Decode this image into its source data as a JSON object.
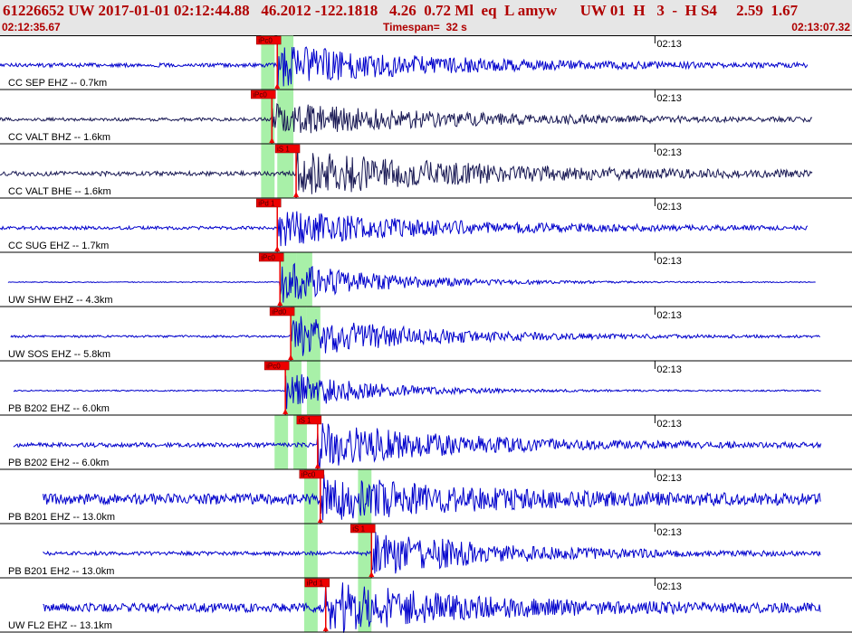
{
  "header": {
    "title": "61226652 UW 2017-01-01 02:12:44.88   46.2012 -122.1818   4.26  0.72 Ml  eq  L amyw      UW 01  H   3  -  H S4     2.59  1.67",
    "start_time": "02:12:35.67",
    "timespan": "Timespan=  32 s",
    "end_time": "02:13:07.32"
  },
  "colors": {
    "header_bg": "#e6e6e6",
    "header_text": "#b00000",
    "trace_blue": "#0000cc",
    "trace_dark": "#1a1a55",
    "pick_box": "#ee0000",
    "pick_window": "#a8f0a8"
  },
  "chart_data": {
    "type": "line",
    "title": "",
    "xlabel": "",
    "ylabel": "",
    "x_unit": "seconds after 02:12:35.67",
    "xlim": [
      0,
      31.65
    ],
    "minute_mark": {
      "label": "02:13",
      "time_s": 24.33
    },
    "traces": [
      {
        "station": "CC SEP EHZ -- 0.7km",
        "color": "#0000cc",
        "noise": 0.035,
        "amp": 0.38,
        "decay": 5.5,
        "start_s": 0.0,
        "end_s": 30.0,
        "picks": [
          {
            "label": "iPc0",
            "time_s": 10.3
          }
        ],
        "windows": [
          [
            9.7,
            10.2
          ],
          [
            10.3,
            10.9
          ]
        ]
      },
      {
        "station": "CC VALT BHZ -- 1.6km",
        "color": "#1a1a55",
        "noise": 0.03,
        "amp": 0.3,
        "decay": 6.5,
        "start_s": 0.0,
        "end_s": 30.2,
        "picks": [
          {
            "label": "iPc0",
            "time_s": 10.1
          }
        ],
        "windows": [
          [
            9.7,
            10.2
          ],
          [
            10.3,
            10.9
          ]
        ]
      },
      {
        "station": "CC VALT BHE -- 1.6km",
        "color": "#1a1a55",
        "noise": 0.04,
        "amp": 0.4,
        "decay": 7.0,
        "start_s": 0.0,
        "end_s": 30.2,
        "picks": [
          {
            "label": "iS 1",
            "time_s": 11.0
          }
        ],
        "windows": [
          [
            9.7,
            10.2
          ],
          [
            10.3,
            10.9
          ]
        ]
      },
      {
        "station": "CC SUG EHZ -- 1.7km",
        "color": "#0000cc",
        "noise": 0.03,
        "amp": 0.32,
        "decay": 6.0,
        "start_s": 0.0,
        "end_s": 30.0,
        "picks": [
          {
            "label": "iPd 1",
            "time_s": 10.3
          }
        ],
        "windows": []
      },
      {
        "station": "UW SHW EHZ -- 4.3km",
        "color": "#0000cc",
        "noise": 0.008,
        "amp": 0.42,
        "decay": 3.5,
        "start_s": 0.3,
        "end_s": 30.3,
        "picks": [
          {
            "label": "iPc0",
            "time_s": 10.4
          }
        ],
        "windows": [
          [
            10.4,
            11.0
          ],
          [
            11.0,
            11.6
          ]
        ]
      },
      {
        "station": "UW SOS EHZ -- 5.8km",
        "color": "#0000cc",
        "noise": 0.02,
        "amp": 0.4,
        "decay": 4.5,
        "start_s": 0.4,
        "end_s": 30.5,
        "picks": [
          {
            "label": "iPd0",
            "time_s": 10.8
          }
        ],
        "windows": [
          [
            10.8,
            11.4
          ],
          [
            11.4,
            11.9
          ]
        ]
      },
      {
        "station": "PB B202 EHZ -- 6.0km",
        "color": "#0000cc",
        "noise": 0.012,
        "amp": 0.38,
        "decay": 3.0,
        "start_s": 0.5,
        "end_s": 30.5,
        "picks": [
          {
            "label": "iPc0",
            "time_s": 10.6
          }
        ],
        "windows": [
          [
            10.6,
            11.2
          ],
          [
            11.4,
            11.9
          ]
        ]
      },
      {
        "station": "PB B202 EH2 -- 6.0km",
        "color": "#0000cc",
        "noise": 0.04,
        "amp": 0.42,
        "decay": 5.0,
        "start_s": 0.5,
        "end_s": 30.5,
        "picks": [
          {
            "label": "iS 1",
            "time_s": 11.8
          }
        ],
        "windows": [
          [
            10.2,
            10.7
          ],
          [
            10.9,
            11.4
          ]
        ]
      },
      {
        "station": "PB B201 EHZ -- 13.0km",
        "color": "#0000cc",
        "noise": 0.1,
        "amp": 0.4,
        "decay": 5.0,
        "start_s": 1.6,
        "end_s": 30.5,
        "picks": [
          {
            "label": "iPc0",
            "time_s": 11.9
          }
        ],
        "windows": [
          [
            11.3,
            11.8
          ],
          [
            13.3,
            13.8
          ]
        ]
      },
      {
        "station": "PB B201 EH2 -- 13.0km",
        "color": "#0000cc",
        "noise": 0.035,
        "amp": 0.42,
        "decay": 4.5,
        "start_s": 1.6,
        "end_s": 30.5,
        "picks": [
          {
            "label": "iS 1",
            "time_s": 13.8
          }
        ],
        "windows": [
          [
            11.3,
            11.8
          ],
          [
            13.3,
            13.8
          ]
        ]
      },
      {
        "station": "UW FL2 EHZ -- 13.1km",
        "color": "#0000cc",
        "noise": 0.08,
        "amp": 0.45,
        "decay": 5.0,
        "start_s": 1.6,
        "end_s": 30.5,
        "picks": [
          {
            "label": "iPd 1",
            "time_s": 12.1
          }
        ],
        "windows": [
          [
            11.3,
            11.8
          ],
          [
            13.3,
            13.8
          ]
        ]
      }
    ]
  }
}
